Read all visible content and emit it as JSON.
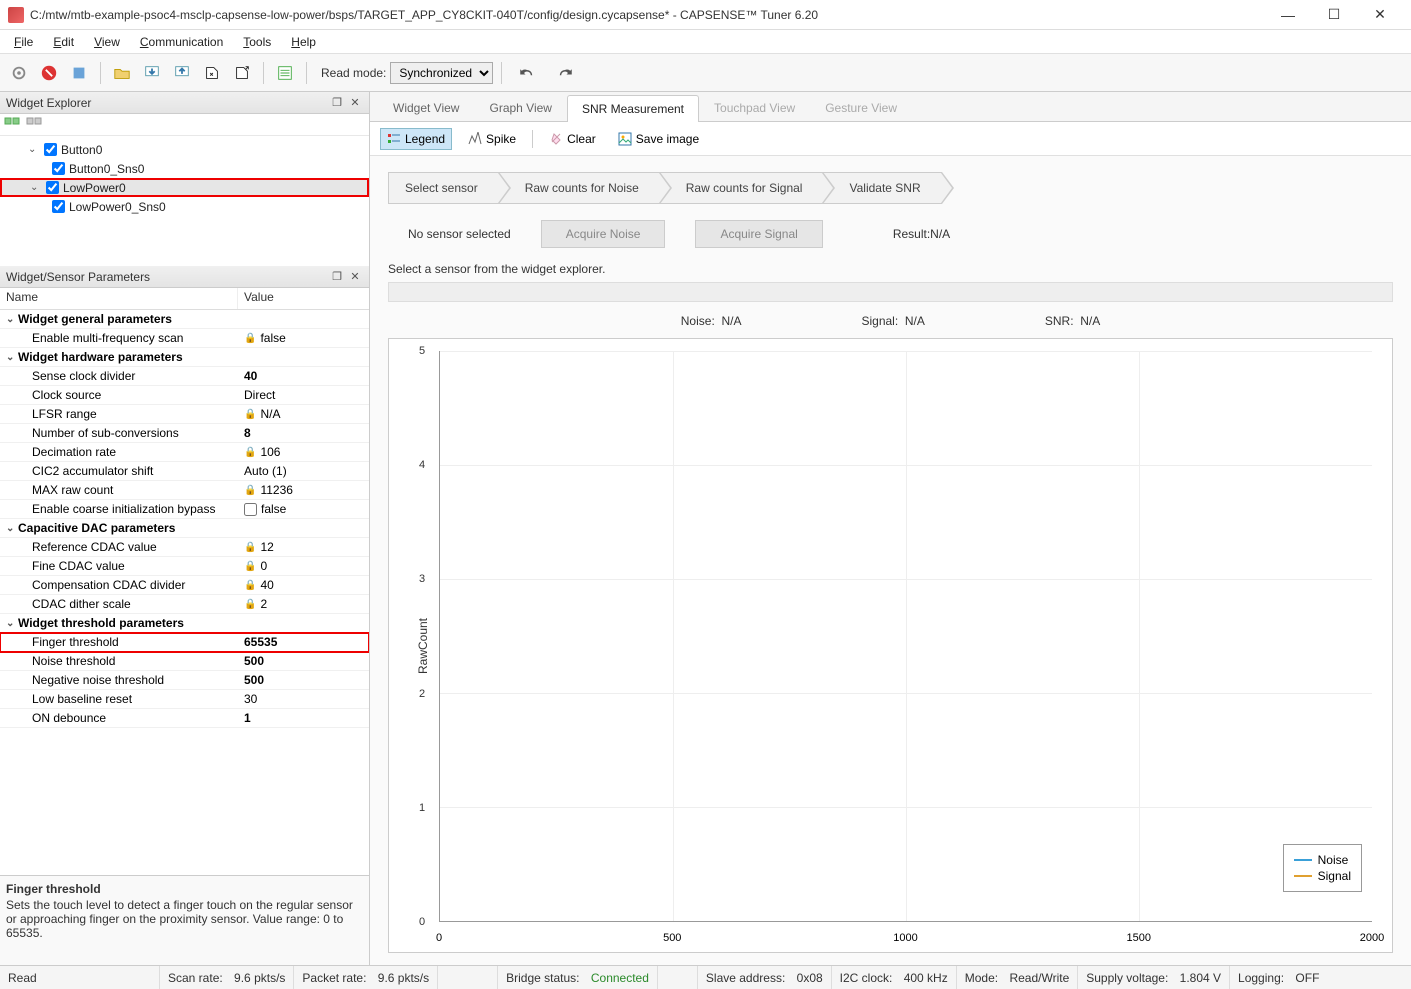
{
  "window": {
    "title": "C:/mtw/mtb-example-psoc4-msclp-capsense-low-power/bsps/TARGET_APP_CY8CKIT-040T/config/design.cycapsense* - CAPSENSE™ Tuner 6.20"
  },
  "menu": {
    "file": "File",
    "edit": "Edit",
    "view": "View",
    "communication": "Communication",
    "tools": "Tools",
    "help": "Help"
  },
  "toolbar": {
    "read_mode_label": "Read mode:",
    "read_mode_value": "Synchronized"
  },
  "widget_explorer": {
    "title": "Widget Explorer",
    "items": [
      {
        "label": "Button0",
        "children": [
          {
            "label": "Button0_Sns0"
          }
        ]
      },
      {
        "label": "LowPower0",
        "selected": true,
        "highlight": true,
        "children": [
          {
            "label": "LowPower0_Sns0"
          }
        ]
      }
    ]
  },
  "params_panel": {
    "title": "Widget/Sensor Parameters",
    "col_name": "Name",
    "col_value": "Value",
    "groups": [
      {
        "label": "Widget general parameters",
        "rows": [
          {
            "name": "Enable multi-frequency scan",
            "value": "false",
            "locked": true
          }
        ]
      },
      {
        "label": "Widget hardware parameters",
        "rows": [
          {
            "name": "Sense clock divider",
            "value": "40",
            "bold": true
          },
          {
            "name": "Clock source",
            "value": "Direct"
          },
          {
            "name": "LFSR range",
            "value": "N/A",
            "locked": true
          },
          {
            "name": "Number of sub-conversions",
            "value": "8",
            "bold": true
          },
          {
            "name": "Decimation rate",
            "value": "106",
            "locked": true
          },
          {
            "name": "CIC2 accumulator shift",
            "value": "Auto (1)"
          },
          {
            "name": "MAX raw count",
            "value": "11236",
            "locked": true
          },
          {
            "name": "Enable coarse initialization bypass",
            "value": "false",
            "checkbox": true
          }
        ]
      },
      {
        "label": "Capacitive DAC parameters",
        "rows": [
          {
            "name": "Reference CDAC value",
            "value": "12",
            "locked": true
          },
          {
            "name": "Fine CDAC value",
            "value": "0",
            "locked": true
          },
          {
            "name": "Compensation CDAC divider",
            "value": "40",
            "locked": true
          },
          {
            "name": "CDAC dither scale",
            "value": "2",
            "locked": true
          }
        ]
      },
      {
        "label": "Widget threshold parameters",
        "rows": [
          {
            "name": "Finger threshold",
            "value": "65535",
            "bold": true,
            "highlight": true
          },
          {
            "name": "Noise threshold",
            "value": "500",
            "bold": true
          },
          {
            "name": "Negative noise threshold",
            "value": "500",
            "bold": true
          },
          {
            "name": "Low baseline reset",
            "value": "30"
          },
          {
            "name": "ON debounce",
            "value": "1",
            "bold": true
          }
        ]
      }
    ],
    "description": {
      "title": "Finger threshold",
      "body": "Sets the touch level to detect a finger touch on the regular sensor or approaching finger on the proximity sensor. Value range: 0 to 65535."
    }
  },
  "tabs": {
    "widget_view": "Widget View",
    "graph_view": "Graph View",
    "snr": "SNR Measurement",
    "touchpad": "Touchpad View",
    "gesture": "Gesture View"
  },
  "snr": {
    "legend_btn": "Legend",
    "spike_btn": "Spike",
    "clear_btn": "Clear",
    "save_btn": "Save image",
    "steps": {
      "s1": "Select sensor",
      "s2": "Raw counts for Noise",
      "s3": "Raw counts for Signal",
      "s4": "Validate SNR"
    },
    "no_sensor": "No sensor selected",
    "acquire_noise": "Acquire Noise",
    "acquire_signal": "Acquire Signal",
    "result_label": "Result:N/A",
    "hint": "Select a sensor from the widget explorer.",
    "noise_label": "Noise:",
    "noise_val": "N/A",
    "signal_label": "Signal:",
    "signal_val": "N/A",
    "snr_label": "SNR:",
    "snr_val": "N/A",
    "legend_noise": "Noise",
    "legend_signal": "Signal"
  },
  "chart_data": {
    "type": "line",
    "series": [
      {
        "name": "Noise",
        "color": "#3aa0d8",
        "values": []
      },
      {
        "name": "Signal",
        "color": "#e0a030",
        "values": []
      }
    ],
    "x": [],
    "xlabel": "",
    "ylabel": "RawCount",
    "xlim": [
      0,
      2000
    ],
    "ylim": [
      0,
      5
    ],
    "xticks": [
      0,
      500,
      1000,
      1500,
      2000
    ],
    "yticks": [
      0,
      1,
      2,
      3,
      4,
      5
    ]
  },
  "status": {
    "read": "Read",
    "scan_rate_l": "Scan rate:",
    "scan_rate_v": "9.6 pkts/s",
    "packet_rate_l": "Packet rate:",
    "packet_rate_v": "9.6 pkts/s",
    "bridge_l": "Bridge status:",
    "bridge_v": "Connected",
    "slave_l": "Slave address:",
    "slave_v": "0x08",
    "i2c_l": "I2C clock:",
    "i2c_v": "400 kHz",
    "mode_l": "Mode:",
    "mode_v": "Read/Write",
    "supply_l": "Supply voltage:",
    "supply_v": "1.804 V",
    "log_l": "Logging:",
    "log_v": "OFF"
  }
}
